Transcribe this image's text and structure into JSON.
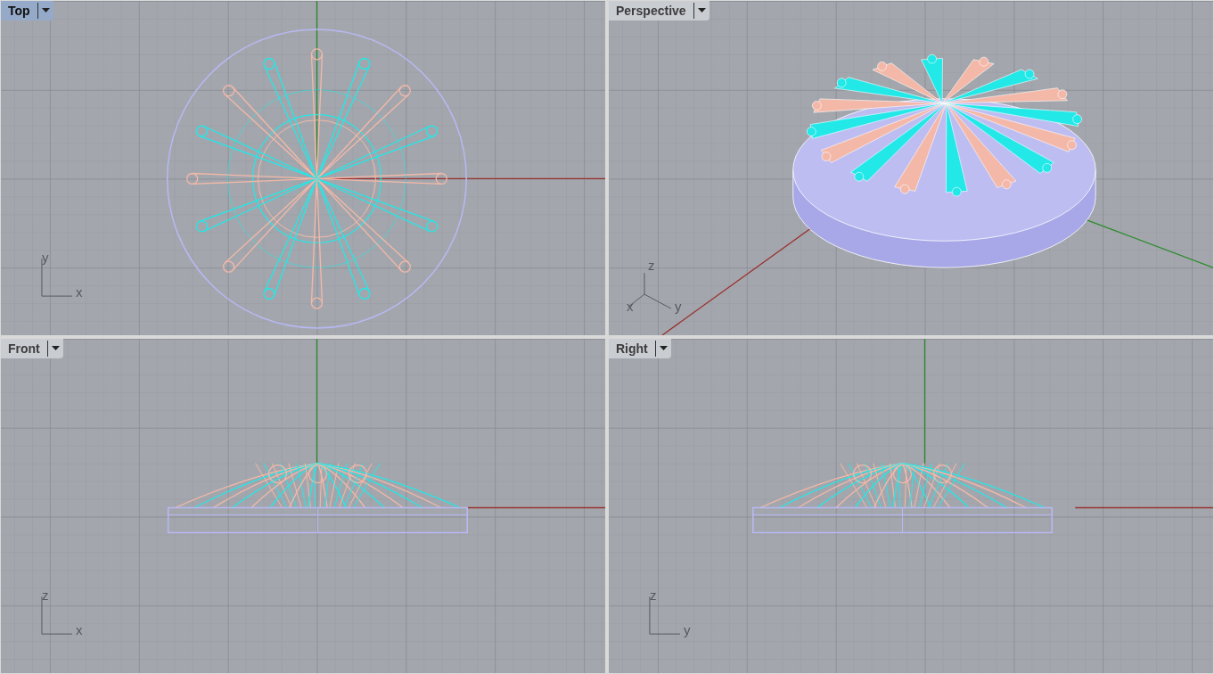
{
  "viewports": [
    {
      "title": "Top",
      "selected": true,
      "kind": "top",
      "axis_labels": [
        "y",
        "x"
      ]
    },
    {
      "title": "Perspective",
      "selected": false,
      "kind": "perspective",
      "axis_labels": [
        "z",
        "x",
        "y"
      ]
    },
    {
      "title": "Front",
      "selected": false,
      "kind": "front",
      "axis_labels": [
        "z",
        "x"
      ]
    },
    {
      "title": "Right",
      "selected": false,
      "kind": "right",
      "axis_labels": [
        "z",
        "y"
      ]
    }
  ]
}
